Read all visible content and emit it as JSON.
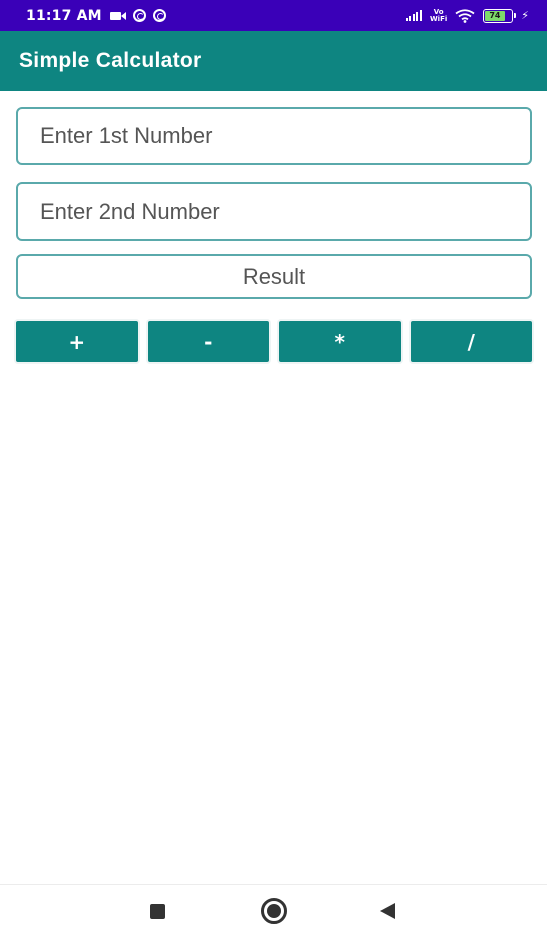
{
  "status_bar": {
    "time": "11:17 AM",
    "battery_level": "74",
    "icons": [
      "video-icon",
      "sync-icon",
      "sync-icon",
      "signal-icon",
      "volte-icon",
      "wifi-icon",
      "battery-icon",
      "charging-icon"
    ],
    "volte_label_top": "Vo",
    "volte_label_bottom": "WiFi"
  },
  "app_bar": {
    "title": "Simple Calculator",
    "color": "#0e8581"
  },
  "form": {
    "first_number": {
      "value": "",
      "placeholder": "Enter 1st Number"
    },
    "second_number": {
      "value": "",
      "placeholder": "Enter 2nd Number"
    },
    "result_label": "Result"
  },
  "operations": {
    "add_label": "+",
    "subtract_label": "-",
    "multiply_label": "*",
    "divide_label": "/"
  },
  "navigation": {
    "icons": [
      "recents-icon",
      "home-icon",
      "back-icon"
    ]
  },
  "colors": {
    "status_bar": "#3a00b8",
    "accent": "#0e8581",
    "field_border": "#5aa9ab"
  }
}
